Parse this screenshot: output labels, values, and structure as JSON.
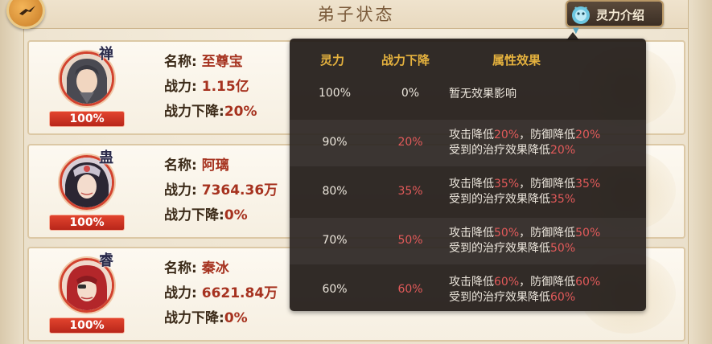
{
  "page": {
    "title": "弟子状态",
    "intro_button": "灵力介绍"
  },
  "disciples": [
    {
      "badge": "禅",
      "spirit_pct": "100%",
      "name_label": "名称:",
      "name": "至尊宝",
      "power_label": "战力:",
      "power": "1.15亿",
      "drop_label": "战力下降:",
      "drop": "20%"
    },
    {
      "badge": "蛊",
      "spirit_pct": "100%",
      "name_label": "名称:",
      "name": "阿璃",
      "power_label": "战力:",
      "power": "7364.36万",
      "drop_label": "战力下降:",
      "drop": "0%"
    },
    {
      "badge": "睿",
      "spirit_pct": "100%",
      "name_label": "名称:",
      "name": "秦冰",
      "power_label": "战力:",
      "power": "6621.84万",
      "drop_label": "战力下降:",
      "drop": "0%"
    }
  ],
  "tooltip": {
    "headers": [
      "灵力",
      "战力下降",
      "属性效果"
    ],
    "rows": [
      {
        "spirit": "100%",
        "drop": "0%",
        "effect_text": "暂无效果影响"
      },
      {
        "spirit": "90%",
        "drop": "20%",
        "atk_prefix": "攻击降低",
        "atk": "20%",
        "def_prefix": "，防御降低",
        "def": "20%",
        "heal_prefix": "受到的治疗效果降低",
        "heal": "20%"
      },
      {
        "spirit": "80%",
        "drop": "35%",
        "atk_prefix": "攻击降低",
        "atk": "35%",
        "def_prefix": "，防御降低",
        "def": "35%",
        "heal_prefix": "受到的治疗效果降低",
        "heal": "35%"
      },
      {
        "spirit": "70%",
        "drop": "50%",
        "atk_prefix": "攻击降低",
        "atk": "50%",
        "def_prefix": "，防御降低",
        "def": "50%",
        "heal_prefix": "受到的治疗效果降低",
        "heal": "50%"
      },
      {
        "spirit": "60%",
        "drop": "60%",
        "atk_prefix": "攻击降低",
        "atk": "60%",
        "def_prefix": "，防御降低",
        "def": "60%",
        "heal_prefix": "受到的治疗效果降低",
        "heal": "60%"
      }
    ]
  },
  "colors": {
    "accent_red": "#a6321f",
    "tooltip_header": "#e5b23e",
    "tooltip_red": "#e25a5a"
  }
}
